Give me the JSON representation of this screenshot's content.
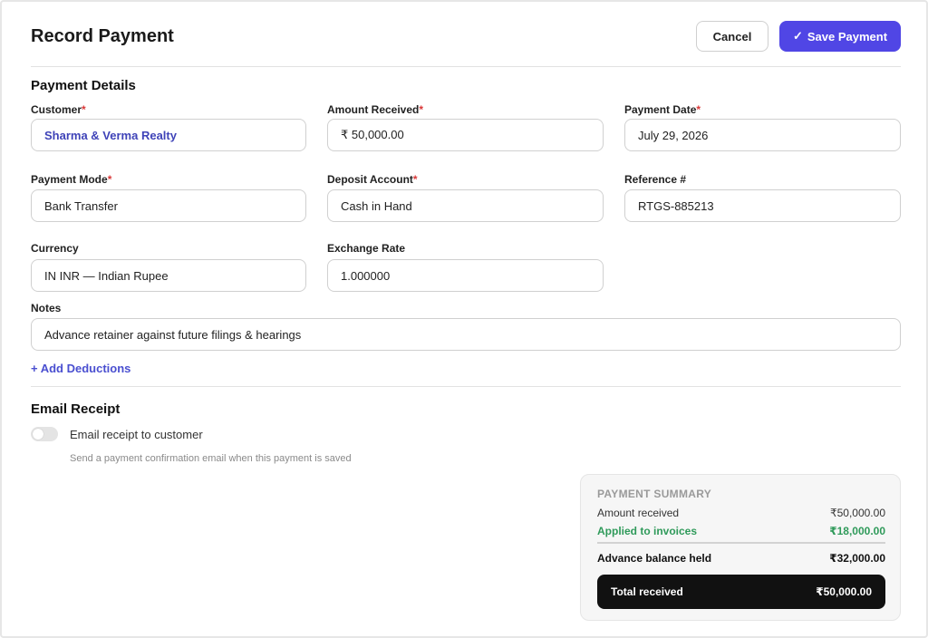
{
  "header": {
    "title": "Record Payment",
    "cancel_label": "Cancel",
    "save_icon": "✓",
    "save_label": "Save Payment"
  },
  "colors": {
    "accent": "#5046e5",
    "success": "#2f9a5a",
    "required": "#d93838"
  },
  "payment_details": {
    "title": "Payment Details",
    "required_mark": "*",
    "customer": {
      "label": "Customer",
      "value": "Sharma & Verma Realty"
    },
    "amount_received": {
      "label": "Amount Received",
      "value": "₹ 50,000.00"
    },
    "payment_date": {
      "label": "Payment Date",
      "value": "July 29, 2026"
    },
    "payment_mode": {
      "label": "Payment Mode",
      "value": "Bank Transfer"
    },
    "deposit_account": {
      "label": "Deposit Account",
      "value": "Cash in Hand"
    },
    "reference": {
      "label": "Reference #",
      "value": "RTGS-885213"
    },
    "currency": {
      "label": "Currency",
      "value": "IN INR — Indian Rupee"
    },
    "exchange_rate": {
      "label": "Exchange Rate",
      "value": "1.000000"
    },
    "notes": {
      "label": "Notes",
      "value": "Advance retainer against future filings & hearings"
    },
    "add_deductions_label": "+ Add Deductions"
  },
  "email_receipt": {
    "title": "Email Receipt",
    "toggle_on": false,
    "toggle_label": "Email receipt to customer",
    "help_text": "Send a payment confirmation email when this payment is saved"
  },
  "summary": {
    "heading": "PAYMENT SUMMARY",
    "amount_received_label": "Amount received",
    "amount_received_value": "₹50,000.00",
    "applied_label": "Applied to invoices",
    "applied_value": "₹18,000.00",
    "advance_label": "Advance balance held",
    "advance_value": "₹32,000.00",
    "total_label": "Total received",
    "total_value": "₹50,000.00"
  }
}
